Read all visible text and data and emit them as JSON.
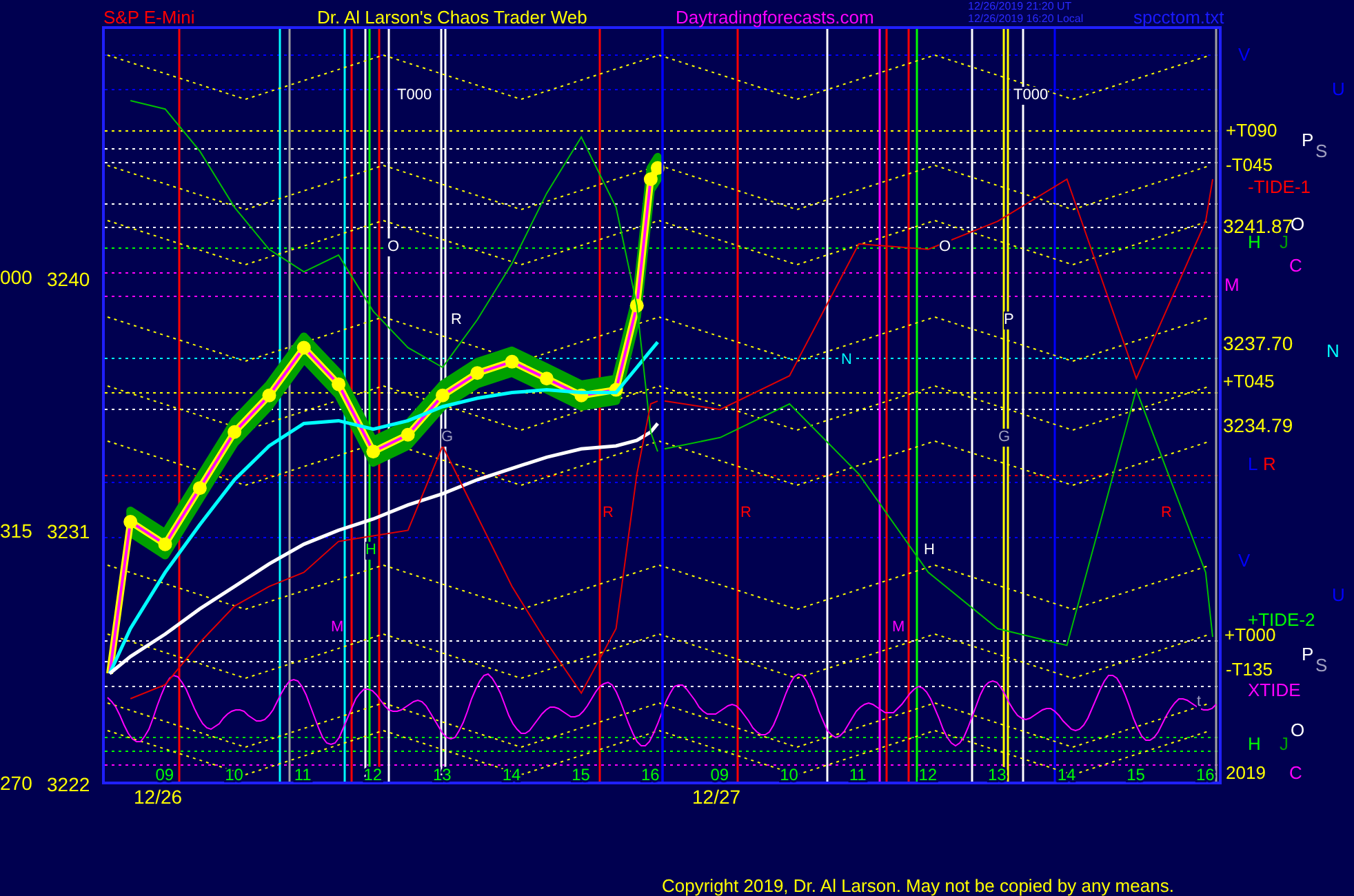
{
  "header": {
    "instrument": "S&P E-Mini",
    "title": "Dr. Al Larson's Chaos Trader Web",
    "site": "Daytradingforecasts.com",
    "timestamps": [
      "12/26/2019 21:20 UT",
      "12/26/2019 16:20 Local"
    ],
    "file": "spcctom.txt"
  },
  "angle_labels": [
    "000",
    "315",
    "270"
  ],
  "panels": [
    {
      "date": "12/26",
      "chart_data": {
        "type": "line",
        "x": [
          8.2,
          8.5,
          9,
          9.5,
          10,
          10.5,
          11,
          11.5,
          12,
          12.5,
          13,
          13.5,
          14,
          14.5,
          15,
          15.5,
          15.8,
          16,
          16.1
        ],
        "xticks": [
          {
            "value": 9,
            "label": "09"
          },
          {
            "value": 10,
            "label": "10"
          },
          {
            "value": 11,
            "label": "11"
          },
          {
            "value": 12,
            "label": "12"
          },
          {
            "value": 13,
            "label": "13"
          },
          {
            "value": 14,
            "label": "14"
          },
          {
            "value": 15,
            "label": "15"
          },
          {
            "value": 16,
            "label": "16"
          }
        ],
        "yticks": [
          {
            "value": 3240,
            "label": "3240"
          },
          {
            "value": 3231,
            "label": "3231"
          },
          {
            "value": 3222,
            "label": "3222"
          }
        ],
        "ylim": [
          3222,
          3248.9
        ],
        "xlim": [
          8.17,
          16.17
        ],
        "series": [
          {
            "color": "#ffff00",
            "marker": "circle",
            "values": [
              3225.9,
              3231.3,
              3230.5,
              3232.5,
              3234.5,
              3235.8,
              3237.5,
              3236.2,
              3233.8,
              3234.4,
              3235.8,
              3236.6,
              3237.0,
              3236.4,
              3235.8,
              3236.0,
              3239.0,
              3243.5,
              3243.9
            ]
          },
          {
            "color": "#00ffff",
            "values": [
              3225.9,
              3227.5,
              3229.5,
              3231.2,
              3232.8,
              3234.0,
              3234.8,
              3234.9,
              3234.6,
              3234.9,
              3235.4,
              3235.7,
              3235.9,
              3236.0,
              3235.9,
              3235.9,
              3236.8,
              3237.4,
              3237.7
            ]
          },
          {
            "color": "#ffffff",
            "values": [
              3225.9,
              3226.5,
              3227.3,
              3228.2,
              3229.0,
              3229.8,
              3230.5,
              3231.0,
              3231.4,
              3231.9,
              3232.3,
              3232.8,
              3233.2,
              3233.6,
              3233.9,
              3234.0,
              3234.2,
              3234.5,
              3234.8
            ]
          },
          {
            "color": "#00c000",
            "values": [
              null,
              3246.3,
              3246.0,
              3244.5,
              3242.5,
              3241.0,
              3240.2,
              3240.8,
              3238.8,
              3237.5,
              3236.8,
              3238.5,
              3240.5,
              3243.0,
              3245.0,
              3242.5,
              3239.0,
              3234.5,
              3233.8
            ]
          },
          {
            "color": "#e00000",
            "values": [
              null,
              3225.0,
              3225.5,
              3227.0,
              3228.3,
              3229.0,
              3229.5,
              3230.6,
              3230.8,
              3231.0,
              3234.0,
              3231.5,
              3229.0,
              3227.0,
              3225.2,
              3227.5,
              3233.0,
              3235.5,
              3235.6
            ]
          }
        ]
      }
    },
    {
      "date": "12/27",
      "chart_data": {
        "type": "line",
        "x": [
          8.2,
          9,
          10,
          11,
          12,
          13,
          14,
          15,
          16,
          16.1
        ],
        "xticks": [
          {
            "value": 9,
            "label": "09"
          },
          {
            "value": 10,
            "label": "10"
          },
          {
            "value": 11,
            "label": "11"
          },
          {
            "value": 12,
            "label": "12"
          },
          {
            "value": 13,
            "label": "13"
          },
          {
            "value": 14,
            "label": "14"
          },
          {
            "value": 15,
            "label": "15"
          },
          {
            "value": 16,
            "label": "16"
          }
        ],
        "yticks": [
          {
            "value": 3241.87,
            "label": "3241.87"
          },
          {
            "value": 3237.7,
            "label": "3237.70"
          },
          {
            "value": 3234.79,
            "label": "3234.79"
          }
        ],
        "ylim": [
          3222,
          3248.9
        ],
        "xlim": [
          8.17,
          16.17
        ],
        "series": [
          {
            "color": "#00c000",
            "values": [
              3233.9,
              3234.3,
              3235.5,
              3233.0,
              3229.5,
              3227.5,
              3226.9,
              3236.0,
              3229.5,
              3227.2
            ]
          },
          {
            "color": "#e00000",
            "values": [
              3235.6,
              3235.3,
              3236.5,
              3241.2,
              3241.0,
              3242.0,
              3243.5,
              3236.4,
              3242.0,
              3243.5
            ]
          }
        ]
      }
    }
  ],
  "right_labels": [
    {
      "text": "+T090",
      "color": "#ffff00"
    },
    {
      "text": "-T045",
      "color": "#ffff00"
    },
    {
      "text": "-TIDE-1",
      "color": "#ff0000"
    },
    {
      "text": "M",
      "color": "#ff00ff"
    },
    {
      "text": "+T045",
      "color": "#ffff00"
    },
    {
      "text": "+TIDE-2",
      "color": "#00ff00"
    },
    {
      "text": "+T000",
      "color": "#ffff00"
    },
    {
      "text": "-T135",
      "color": "#ffff00"
    },
    {
      "text": "XTIDE",
      "color": "#ff00ff"
    },
    {
      "text": "2019",
      "color": "#ffff00"
    }
  ],
  "side_markers": [
    {
      "text": "V",
      "color": "#0000ff"
    },
    {
      "text": "U",
      "color": "#0000ff"
    },
    {
      "text": "P",
      "color": "#ffffff"
    },
    {
      "text": "S",
      "color": "#a0a0c0"
    },
    {
      "text": "O",
      "color": "#ffffff"
    },
    {
      "text": "H",
      "color": "#00ff00"
    },
    {
      "text": "J",
      "color": "#00a000"
    },
    {
      "text": "C",
      "color": "#ff00ff"
    },
    {
      "text": "N",
      "color": "#00ffff"
    },
    {
      "text": "L",
      "color": "#0000ff"
    },
    {
      "text": "R",
      "color": "#ff0000"
    },
    {
      "text": "V",
      "color": "#0000ff"
    },
    {
      "text": "U",
      "color": "#0000ff"
    },
    {
      "text": "P",
      "color": "#ffffff"
    },
    {
      "text": "S",
      "color": "#a0a0c0"
    },
    {
      "text": "O",
      "color": "#ffffff"
    },
    {
      "text": "H",
      "color": "#00ff00"
    },
    {
      "text": "J",
      "color": "#00a000"
    },
    {
      "text": "C",
      "color": "#ff00ff"
    }
  ],
  "plot_markers": [
    {
      "text": "T000",
      "color": "#ffffff"
    },
    {
      "text": "T000",
      "color": "#ffffff"
    },
    {
      "text": "O",
      "color": "#ffffff"
    },
    {
      "text": "O",
      "color": "#ffffff"
    },
    {
      "text": "R",
      "color": "#ffffff"
    },
    {
      "text": "P",
      "color": "#ffffff"
    },
    {
      "text": "N",
      "color": "#00ffff"
    },
    {
      "text": "G",
      "color": "#a0a0c0"
    },
    {
      "text": "G",
      "color": "#a0a0c0"
    },
    {
      "text": "R",
      "color": "#ff0000"
    },
    {
      "text": "R",
      "color": "#ff0000"
    },
    {
      "text": "R",
      "color": "#ff0000"
    },
    {
      "text": "H",
      "color": "#00ff00"
    },
    {
      "text": "H",
      "color": "#ffffff"
    },
    {
      "text": "M",
      "color": "#ff00ff"
    },
    {
      "text": "M",
      "color": "#ff00ff"
    },
    {
      "text": "t",
      "color": "#a0a0c0"
    }
  ],
  "copyright": "Copyright 2019, Dr. Al Larson. May not be copied by any means."
}
